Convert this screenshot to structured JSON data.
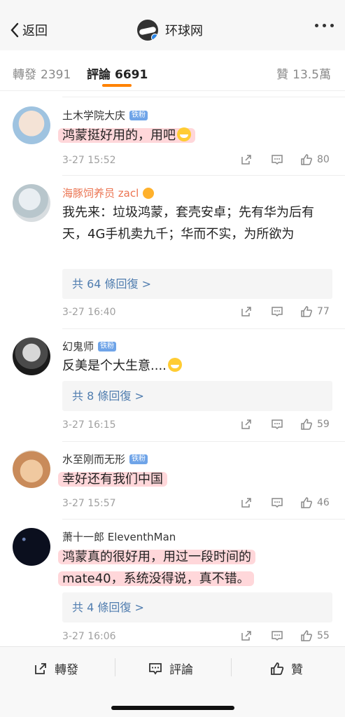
{
  "nav": {
    "back_label": "返回",
    "title": "环球网"
  },
  "tabs": {
    "repost_label": "轉發",
    "repost_count": "2391",
    "comment_label": "評論",
    "comment_count": "6691",
    "like_label": "贊",
    "like_count": "13.5萬"
  },
  "comments": [
    {
      "user": "土木学院大庆",
      "badge": "铁粉",
      "text": "鸿蒙挺好用的，用吧",
      "emoji": "grinning-emoji",
      "time": "3-27 15:52",
      "likes": "80"
    },
    {
      "user": "海豚饲养员 zacl",
      "badge": "",
      "text": "我先来：垃圾鸿蒙，套壳安卓；先有华为后有天，4G手机卖九千；华而不实，为所欲为",
      "replies": "共 64 條回復 >",
      "time": "3-27 16:40",
      "likes": "77"
    },
    {
      "user": "幻鬼师",
      "badge": "铁粉",
      "text": "反美是个大生意....",
      "emoji": "laughing-crying-emoji",
      "replies": "共 8 條回復 >",
      "time": "3-27 16:15",
      "likes": "59"
    },
    {
      "user": "水至刚而无形",
      "badge": "铁粉",
      "text": "幸好还有我们中国",
      "time": "3-27 15:57",
      "likes": "46"
    },
    {
      "user": "萧十一郎 EleventhMan",
      "badge": "",
      "text_line1": "鸿蒙真的很好用，用过一段时间的",
      "text_line2": "mate40，系统没得说，真不错。",
      "replies": "共 4 條回復 >",
      "time": "3-27 16:06",
      "likes": "55"
    }
  ],
  "bottom": {
    "repost": "轉發",
    "comment": "評論",
    "like": "贊"
  },
  "colors": {
    "accent": "#ff8200",
    "link": "#507daf",
    "highlight": "#ffb3bb"
  }
}
